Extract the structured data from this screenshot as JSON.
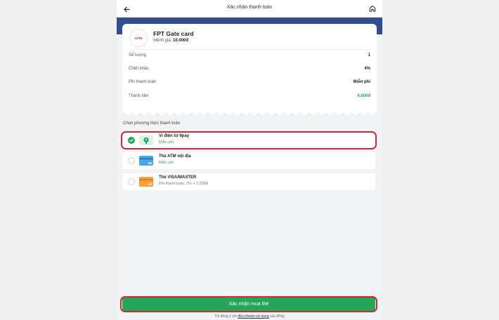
{
  "header": {
    "title": "Xác nhận thanh toán",
    "back_icon": "arrow-left-icon",
    "home_icon": "home-icon"
  },
  "product": {
    "logo_text": "GATE",
    "name": "FPT Gate card",
    "denomination_label": "Mệnh giá:",
    "denomination_value": "10.000đ"
  },
  "summary": [
    {
      "label": "Số lượng",
      "value": "1"
    },
    {
      "label": "Chiết khấu",
      "value": "4%"
    },
    {
      "label": "Phí thanh toán",
      "value": "Miễn phí"
    },
    {
      "label": "Thành tiền",
      "value": "9.600đ"
    }
  ],
  "payment": {
    "section_title": "Chọn phương thức thanh toán",
    "methods": [
      {
        "name": "Ví điện tử 9pay",
        "fee": "Miễn phí",
        "selected": true,
        "icon": "9pay-wallet-icon"
      },
      {
        "name": "Thẻ ATM nội địa",
        "fee": "Miễn phí",
        "selected": false,
        "icon": "atm-card-icon"
      },
      {
        "name": "Thẻ VISA/MASTER",
        "fee": "Phí thanh toán: 2% + 2.200đ",
        "selected": false,
        "icon": "visa-card-icon"
      }
    ]
  },
  "confirm": {
    "button_label": "Xác nhận mua thẻ",
    "terms_prefix": "Tôi đồng ý với",
    "terms_link": "điều khoản sử dụng",
    "terms_suffix": "của 9Pay"
  },
  "colors": {
    "primary_blue": "#2f4d8f",
    "success_green": "#27a55a",
    "highlight_red": "#cc2a36"
  }
}
